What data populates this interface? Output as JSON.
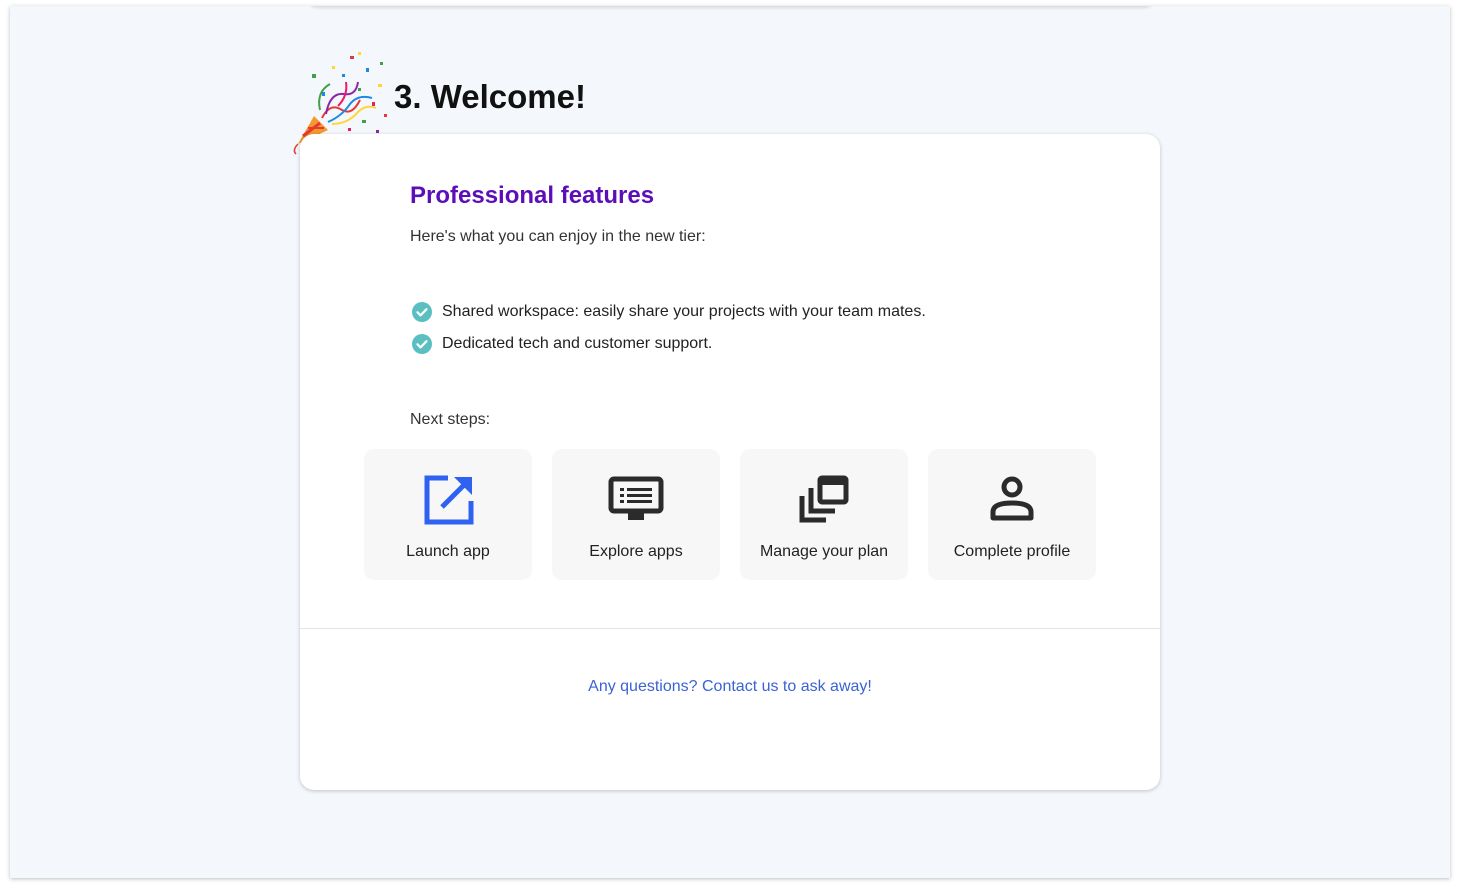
{
  "header": {
    "step_title": "3. Welcome!"
  },
  "card": {
    "title": "Professional features",
    "subtitle": "Here's what you can enjoy in the new tier:",
    "features": [
      "Shared workspace: easily share your projects with your team mates.",
      "Dedicated tech and customer support."
    ],
    "next_steps_label": "Next steps:",
    "next_steps": [
      {
        "label": "Launch app",
        "icon": "external-link-icon"
      },
      {
        "label": "Explore apps",
        "icon": "monitor-list-icon"
      },
      {
        "label": "Manage your plan",
        "icon": "layers-icon"
      },
      {
        "label": "Complete profile",
        "icon": "user-icon"
      }
    ],
    "contact_link": "Any questions? Contact us to ask away!"
  },
  "colors": {
    "accent_purple": "#5c0fb8",
    "link_blue": "#3a63d4",
    "check_teal": "#5bbfc2",
    "launch_icon_blue": "#2f62f0",
    "background": "#f4f8fc"
  }
}
